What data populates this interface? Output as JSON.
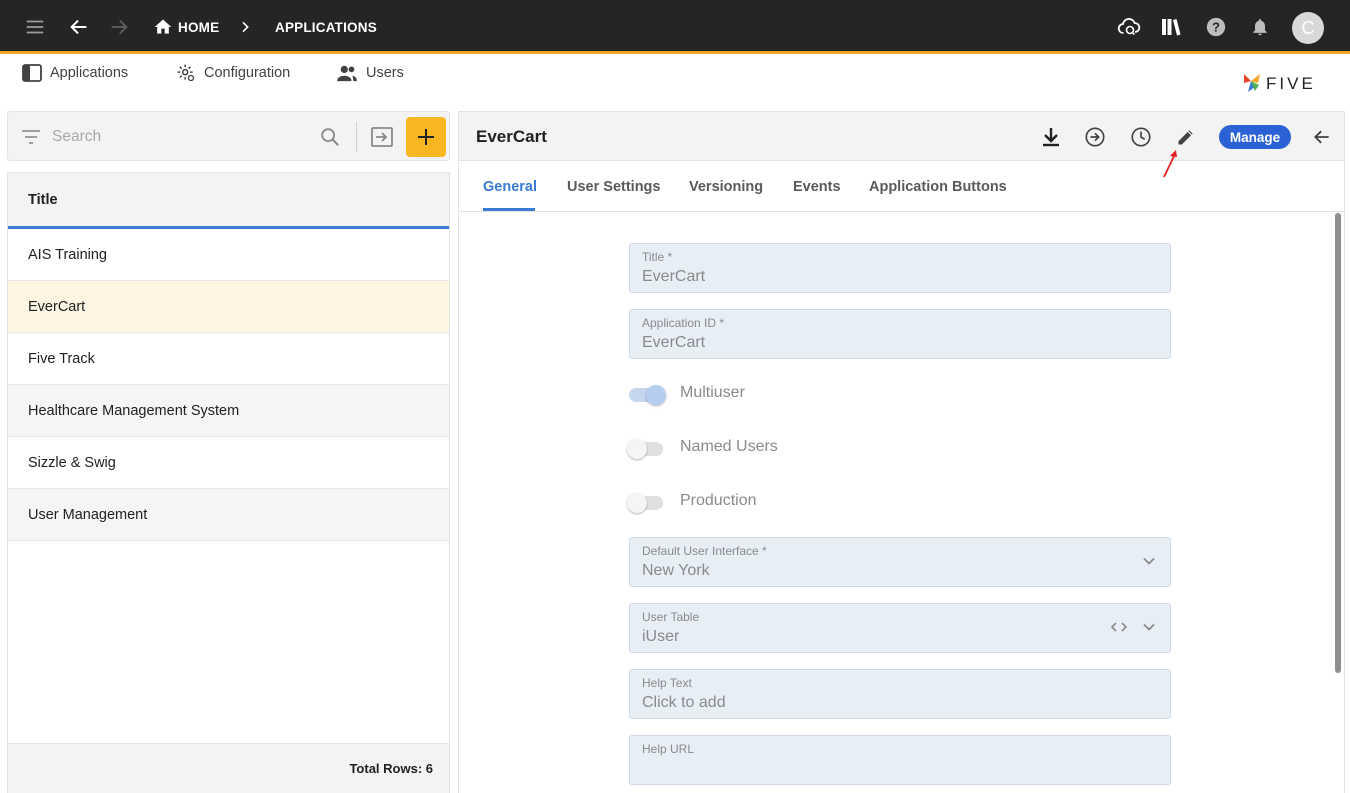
{
  "topbar": {
    "breadcrumb_home": "HOME",
    "breadcrumb_applications": "APPLICATIONS",
    "avatar_initial": "C"
  },
  "nav": {
    "tabs": [
      {
        "label": "Applications",
        "icon": "app-icon"
      },
      {
        "label": "Configuration",
        "icon": "gear-icon"
      },
      {
        "label": "Users",
        "icon": "people-icon"
      }
    ],
    "logo_text": "FIVE"
  },
  "list": {
    "search_placeholder": "Search",
    "column_title": "Title",
    "rows": [
      "AIS Training",
      "EverCart",
      "Five Track",
      "Healthcare Management System",
      "Sizzle & Swig",
      "User Management"
    ],
    "selected_row": "EverCart",
    "footer": "Total Rows: 6"
  },
  "detail": {
    "title": "EverCart",
    "manage_label": "Manage",
    "tabs": [
      "General",
      "User Settings",
      "Versioning",
      "Events",
      "Application Buttons"
    ],
    "active_tab": "General",
    "fields": {
      "title_label": "Title *",
      "title_value": "EverCart",
      "appid_label": "Application ID *",
      "appid_value": "EverCart",
      "ui_label": "Default User Interface *",
      "ui_value": "New York",
      "usertable_label": "User Table",
      "usertable_value": "iUser",
      "helptext_label": "Help Text",
      "helptext_value": "Click to add",
      "helpurl_label": "Help URL",
      "helpurl_value": ""
    },
    "toggles": [
      {
        "label": "Multiuser",
        "on": true
      },
      {
        "label": "Named Users",
        "on": false
      },
      {
        "label": "Production",
        "on": false
      }
    ]
  },
  "colors": {
    "topbar_bg": "#252525",
    "accent_orange": "#f8b720",
    "accent_blue": "#3a7bd5",
    "manage_blue": "#2a62d6"
  }
}
